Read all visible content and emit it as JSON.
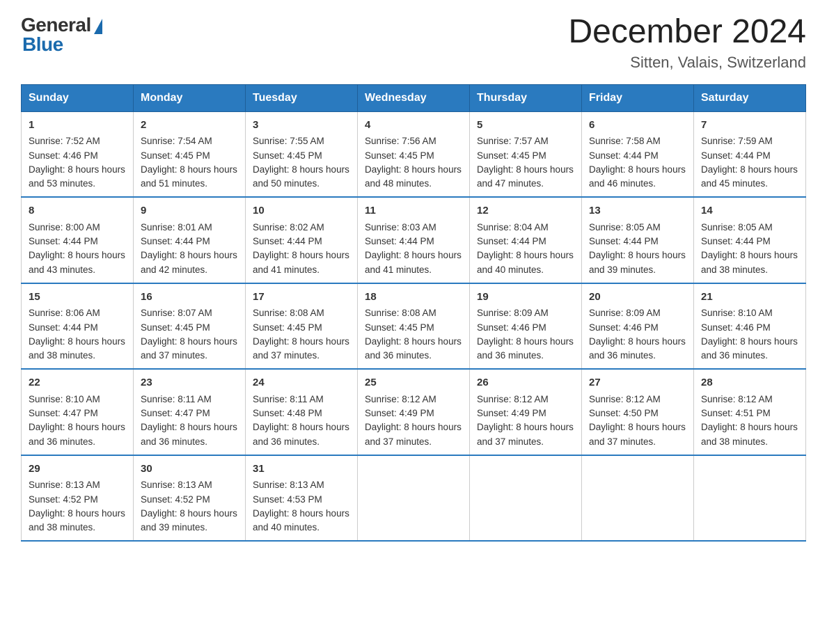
{
  "logo": {
    "general": "General",
    "blue": "Blue"
  },
  "header": {
    "title": "December 2024",
    "subtitle": "Sitten, Valais, Switzerland"
  },
  "weekdays": [
    "Sunday",
    "Monday",
    "Tuesday",
    "Wednesday",
    "Thursday",
    "Friday",
    "Saturday"
  ],
  "weeks": [
    [
      {
        "day": "1",
        "sunrise": "7:52 AM",
        "sunset": "4:46 PM",
        "daylight": "8 hours and 53 minutes."
      },
      {
        "day": "2",
        "sunrise": "7:54 AM",
        "sunset": "4:45 PM",
        "daylight": "8 hours and 51 minutes."
      },
      {
        "day": "3",
        "sunrise": "7:55 AM",
        "sunset": "4:45 PM",
        "daylight": "8 hours and 50 minutes."
      },
      {
        "day": "4",
        "sunrise": "7:56 AM",
        "sunset": "4:45 PM",
        "daylight": "8 hours and 48 minutes."
      },
      {
        "day": "5",
        "sunrise": "7:57 AM",
        "sunset": "4:45 PM",
        "daylight": "8 hours and 47 minutes."
      },
      {
        "day": "6",
        "sunrise": "7:58 AM",
        "sunset": "4:44 PM",
        "daylight": "8 hours and 46 minutes."
      },
      {
        "day": "7",
        "sunrise": "7:59 AM",
        "sunset": "4:44 PM",
        "daylight": "8 hours and 45 minutes."
      }
    ],
    [
      {
        "day": "8",
        "sunrise": "8:00 AM",
        "sunset": "4:44 PM",
        "daylight": "8 hours and 43 minutes."
      },
      {
        "day": "9",
        "sunrise": "8:01 AM",
        "sunset": "4:44 PM",
        "daylight": "8 hours and 42 minutes."
      },
      {
        "day": "10",
        "sunrise": "8:02 AM",
        "sunset": "4:44 PM",
        "daylight": "8 hours and 41 minutes."
      },
      {
        "day": "11",
        "sunrise": "8:03 AM",
        "sunset": "4:44 PM",
        "daylight": "8 hours and 41 minutes."
      },
      {
        "day": "12",
        "sunrise": "8:04 AM",
        "sunset": "4:44 PM",
        "daylight": "8 hours and 40 minutes."
      },
      {
        "day": "13",
        "sunrise": "8:05 AM",
        "sunset": "4:44 PM",
        "daylight": "8 hours and 39 minutes."
      },
      {
        "day": "14",
        "sunrise": "8:05 AM",
        "sunset": "4:44 PM",
        "daylight": "8 hours and 38 minutes."
      }
    ],
    [
      {
        "day": "15",
        "sunrise": "8:06 AM",
        "sunset": "4:44 PM",
        "daylight": "8 hours and 38 minutes."
      },
      {
        "day": "16",
        "sunrise": "8:07 AM",
        "sunset": "4:45 PM",
        "daylight": "8 hours and 37 minutes."
      },
      {
        "day": "17",
        "sunrise": "8:08 AM",
        "sunset": "4:45 PM",
        "daylight": "8 hours and 37 minutes."
      },
      {
        "day": "18",
        "sunrise": "8:08 AM",
        "sunset": "4:45 PM",
        "daylight": "8 hours and 36 minutes."
      },
      {
        "day": "19",
        "sunrise": "8:09 AM",
        "sunset": "4:46 PM",
        "daylight": "8 hours and 36 minutes."
      },
      {
        "day": "20",
        "sunrise": "8:09 AM",
        "sunset": "4:46 PM",
        "daylight": "8 hours and 36 minutes."
      },
      {
        "day": "21",
        "sunrise": "8:10 AM",
        "sunset": "4:46 PM",
        "daylight": "8 hours and 36 minutes."
      }
    ],
    [
      {
        "day": "22",
        "sunrise": "8:10 AM",
        "sunset": "4:47 PM",
        "daylight": "8 hours and 36 minutes."
      },
      {
        "day": "23",
        "sunrise": "8:11 AM",
        "sunset": "4:47 PM",
        "daylight": "8 hours and 36 minutes."
      },
      {
        "day": "24",
        "sunrise": "8:11 AM",
        "sunset": "4:48 PM",
        "daylight": "8 hours and 36 minutes."
      },
      {
        "day": "25",
        "sunrise": "8:12 AM",
        "sunset": "4:49 PM",
        "daylight": "8 hours and 37 minutes."
      },
      {
        "day": "26",
        "sunrise": "8:12 AM",
        "sunset": "4:49 PM",
        "daylight": "8 hours and 37 minutes."
      },
      {
        "day": "27",
        "sunrise": "8:12 AM",
        "sunset": "4:50 PM",
        "daylight": "8 hours and 37 minutes."
      },
      {
        "day": "28",
        "sunrise": "8:12 AM",
        "sunset": "4:51 PM",
        "daylight": "8 hours and 38 minutes."
      }
    ],
    [
      {
        "day": "29",
        "sunrise": "8:13 AM",
        "sunset": "4:52 PM",
        "daylight": "8 hours and 38 minutes."
      },
      {
        "day": "30",
        "sunrise": "8:13 AM",
        "sunset": "4:52 PM",
        "daylight": "8 hours and 39 minutes."
      },
      {
        "day": "31",
        "sunrise": "8:13 AM",
        "sunset": "4:53 PM",
        "daylight": "8 hours and 40 minutes."
      },
      null,
      null,
      null,
      null
    ]
  ],
  "labels": {
    "sunrise_prefix": "Sunrise: ",
    "sunset_prefix": "Sunset: ",
    "daylight_prefix": "Daylight: "
  }
}
